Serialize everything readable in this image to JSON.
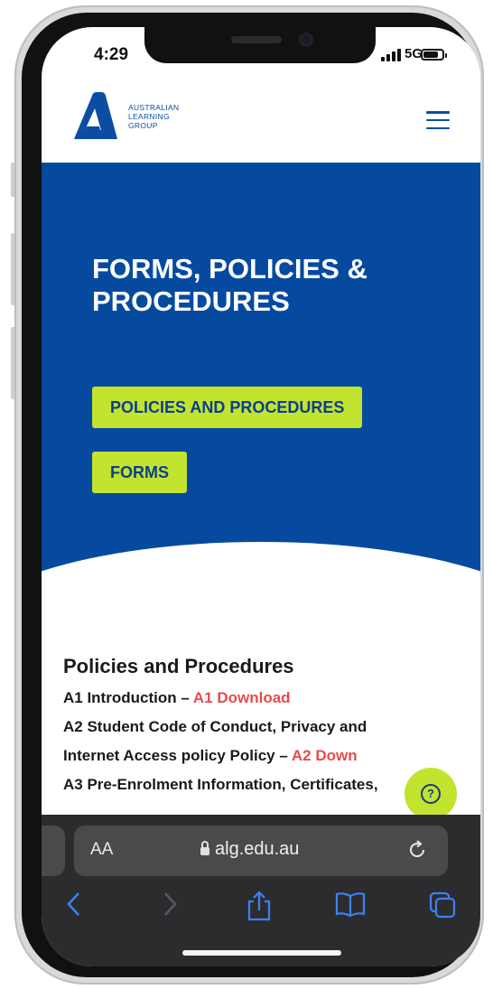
{
  "status_bar": {
    "time": "4:29",
    "network": "5G"
  },
  "site": {
    "logo_text": [
      "AUSTRALIAN",
      "LEARNING",
      "GROUP"
    ],
    "brand_color": "#064aa0",
    "accent_color": "#c2e42f"
  },
  "hero": {
    "title": "FORMS, POLICIES & PROCEDURES",
    "btn_policies": "POLICIES AND PROCEDURES",
    "btn_forms": "FORMS"
  },
  "content": {
    "heading": "Policies and Procedures",
    "lines": [
      {
        "text": "A1 Introduction – ",
        "link": "A1 Download"
      },
      {
        "text": "A2 Student Code of Conduct, Privacy and",
        "link": ""
      },
      {
        "text": "Internet Access policy Policy – ",
        "link": "A2 Down"
      },
      {
        "text": "A3 Pre-Enrolment Information, Certificates,",
        "link": ""
      }
    ]
  },
  "help_button": "?",
  "safari": {
    "aa_label": "AA",
    "url": "alg.edu.au",
    "icons": [
      "back-icon",
      "forward-icon",
      "share-icon",
      "bookmarks-icon",
      "tabs-icon",
      "reload-icon",
      "lock-icon"
    ]
  }
}
